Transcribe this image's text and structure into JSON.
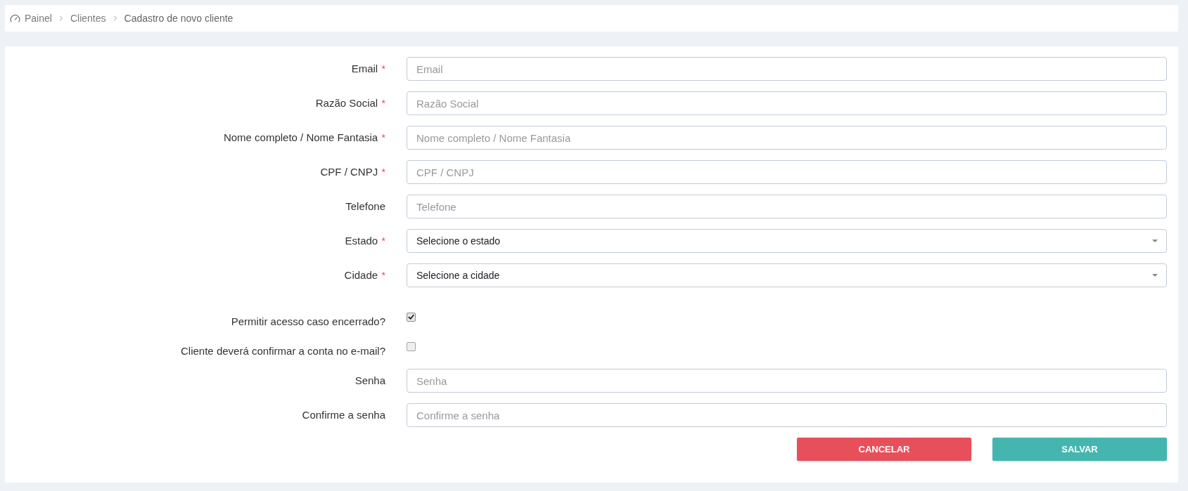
{
  "breadcrumb": [
    {
      "label": "Painel",
      "current": false
    },
    {
      "label": "Clientes",
      "current": false
    },
    {
      "label": "Cadastro de novo cliente",
      "current": true
    }
  ],
  "form": {
    "fields": [
      {
        "kind": "text",
        "label": "Email",
        "required_mark": "*",
        "placeholder": "Email"
      },
      {
        "kind": "text",
        "label": "Razão Social",
        "required_mark": "*",
        "placeholder": "Razão Social"
      },
      {
        "kind": "text",
        "label": "Nome completo / Nome Fantasia",
        "required_mark": "*",
        "placeholder": "Nome completo / Nome Fantasia"
      },
      {
        "kind": "text",
        "label": "CPF / CNPJ",
        "required_mark": "*",
        "placeholder": "CPF / CNPJ"
      },
      {
        "kind": "text",
        "label": "Telefone",
        "placeholder": "Telefone"
      },
      {
        "kind": "select",
        "label": "Estado",
        "required_mark": "*",
        "value": "Selecione o estado"
      },
      {
        "kind": "select",
        "label": "Cidade",
        "required_mark": "*",
        "value": "Selecione a cidade"
      },
      {
        "kind": "checkbox",
        "label": "Permitir acesso caso encerrado?",
        "checked": true
      },
      {
        "kind": "checkbox",
        "label": "Cliente deverá confirmar a conta no e-mail?",
        "checked": false
      },
      {
        "kind": "password",
        "label": "Senha",
        "placeholder": "Senha"
      },
      {
        "kind": "password",
        "label": "Confirme a senha",
        "placeholder": "Confirme a senha"
      }
    ],
    "actions": [
      {
        "kind": "cancel",
        "label": "CANCELAR"
      },
      {
        "kind": "save",
        "label": "SALVAR"
      }
    ]
  }
}
